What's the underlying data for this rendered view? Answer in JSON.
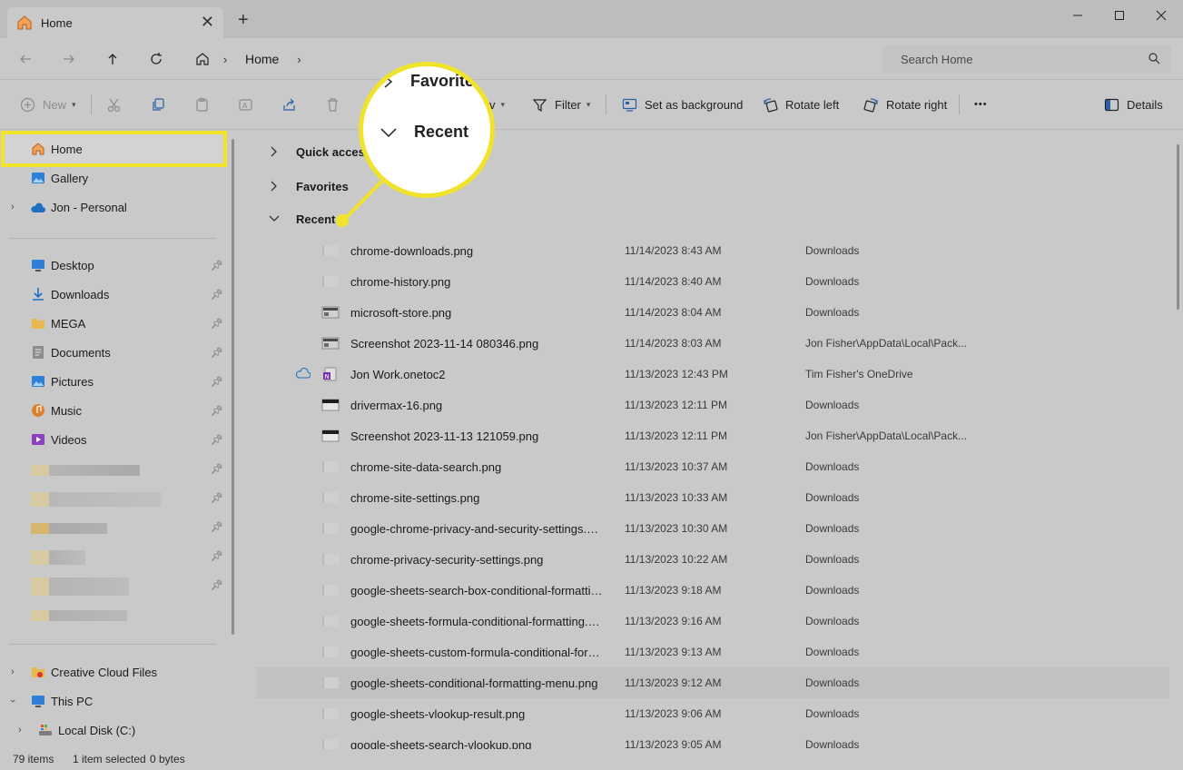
{
  "window": {
    "tab_title": "Home",
    "tab_close": "✕",
    "new_tab": "+"
  },
  "address": {
    "breadcrumb_label": "Home",
    "search_placeholder": "Search Home"
  },
  "toolbar": {
    "new_label": "New",
    "sort_partial": "v",
    "filter_label": "Filter",
    "set_background_label": "Set as background",
    "rotate_left_label": "Rotate left",
    "rotate_right_label": "Rotate right",
    "more_label": "•••",
    "details_label": "Details"
  },
  "sidebar": {
    "home": "Home",
    "gallery": "Gallery",
    "onedrive": "Jon - Personal",
    "quick": [
      {
        "label": "Desktop",
        "icon": "desktop-icon"
      },
      {
        "label": "Downloads",
        "icon": "downloads-icon"
      },
      {
        "label": "MEGA",
        "icon": "folder-icon"
      },
      {
        "label": "Documents",
        "icon": "documents-icon"
      },
      {
        "label": "Pictures",
        "icon": "pictures-icon"
      },
      {
        "label": "Music",
        "icon": "music-icon"
      },
      {
        "label": "Videos",
        "icon": "videos-icon"
      }
    ],
    "creative_cloud": "Creative Cloud Files",
    "this_pc": "This PC",
    "local_disk": "Local Disk (C:)"
  },
  "sections": {
    "quick_access": "Quick access",
    "favorites": "Favorites",
    "recent": "Recent"
  },
  "callout": {
    "favorites": "Favorite",
    "recent": "Recent"
  },
  "files": [
    {
      "name": "chrome-downloads.png",
      "date": "11/14/2023 8:43 AM",
      "location": "Downloads"
    },
    {
      "name": "chrome-history.png",
      "date": "11/14/2023 8:40 AM",
      "location": "Downloads"
    },
    {
      "name": "microsoft-store.png",
      "date": "11/14/2023 8:04 AM",
      "location": "Downloads"
    },
    {
      "name": "Screenshot 2023-11-14 080346.png",
      "date": "11/14/2023 8:03 AM",
      "location": "Jon Fisher\\AppData\\Local\\Pack..."
    },
    {
      "name": "Jon Work.onetoc2",
      "date": "11/13/2023 12:43 PM",
      "location": "Tim Fisher's OneDrive"
    },
    {
      "name": "drivermax-16.png",
      "date": "11/13/2023 12:11 PM",
      "location": "Downloads"
    },
    {
      "name": "Screenshot 2023-11-13 121059.png",
      "date": "11/13/2023 12:11 PM",
      "location": "Jon Fisher\\AppData\\Local\\Pack..."
    },
    {
      "name": "chrome-site-data-search.png",
      "date": "11/13/2023 10:37 AM",
      "location": "Downloads"
    },
    {
      "name": "chrome-site-settings.png",
      "date": "11/13/2023 10:33 AM",
      "location": "Downloads"
    },
    {
      "name": "google-chrome-privacy-and-security-settings.png",
      "date": "11/13/2023 10:30 AM",
      "location": "Downloads"
    },
    {
      "name": "chrome-privacy-security-settings.png",
      "date": "11/13/2023 10:22 AM",
      "location": "Downloads"
    },
    {
      "name": "google-sheets-search-box-conditional-formatting....",
      "date": "11/13/2023 9:18 AM",
      "location": "Downloads"
    },
    {
      "name": "google-sheets-formula-conditional-formatting.png",
      "date": "11/13/2023 9:16 AM",
      "location": "Downloads"
    },
    {
      "name": "google-sheets-custom-formula-conditional-forma...",
      "date": "11/13/2023 9:13 AM",
      "location": "Downloads"
    },
    {
      "name": "google-sheets-conditional-formatting-menu.png",
      "date": "11/13/2023 9:12 AM",
      "location": "Downloads"
    },
    {
      "name": "google-sheets-vlookup-result.png",
      "date": "11/13/2023 9:06 AM",
      "location": "Downloads"
    },
    {
      "name": "google-sheets-search-vlookup.png",
      "date": "11/13/2023 9:05 AM",
      "location": "Downloads"
    }
  ],
  "status": {
    "items": "79 items",
    "selected": "1 item selected",
    "size": "0 bytes"
  },
  "colors": {
    "highlight": "#f1e22a",
    "background": "#c9c9c9"
  }
}
